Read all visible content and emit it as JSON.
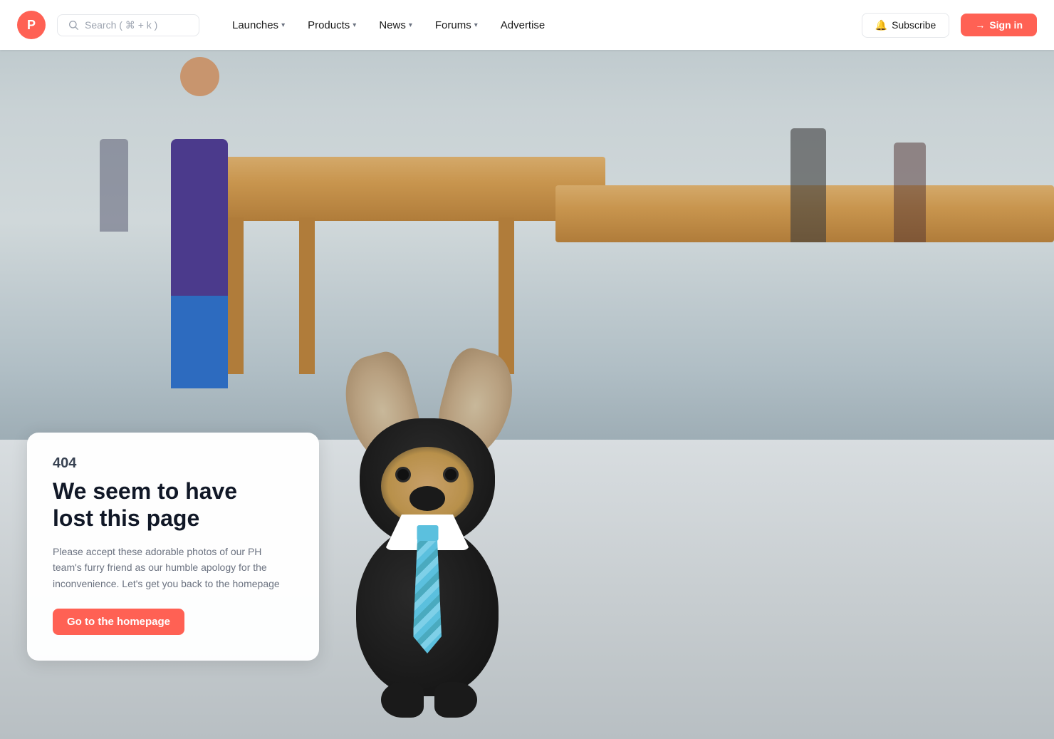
{
  "brand": {
    "logo_letter": "P",
    "logo_color": "#ff6154"
  },
  "navbar": {
    "search_placeholder": "Search ( ⌘ + k )",
    "links": [
      {
        "id": "launches",
        "label": "Launches",
        "has_dropdown": true
      },
      {
        "id": "products",
        "label": "Products",
        "has_dropdown": true
      },
      {
        "id": "news",
        "label": "News",
        "has_dropdown": true
      },
      {
        "id": "forums",
        "label": "Forums",
        "has_dropdown": true
      },
      {
        "id": "advertise",
        "label": "Advertise",
        "has_dropdown": false
      }
    ],
    "subscribe_label": "Subscribe",
    "signin_label": "Sign in"
  },
  "error_page": {
    "code": "404",
    "title_line1": "We seem to have",
    "title_line2": "lost this page",
    "description": "Please accept these adorable photos of our PH team's furry friend as our humble apology for the inconvenience. Let's get you back to the homepage",
    "cta_label": "Go to the homepage"
  }
}
